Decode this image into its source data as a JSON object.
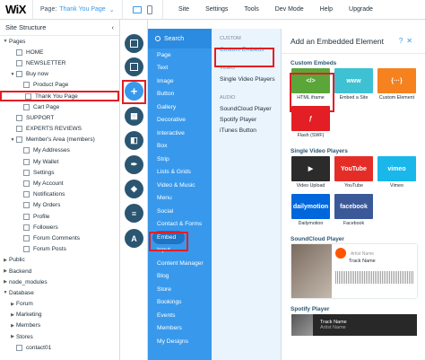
{
  "topbar": {
    "logo": "WiX",
    "page_label": "Page:",
    "page_name": "Thank You Page",
    "menu": [
      "Site",
      "Settings",
      "Tools",
      "Dev Mode",
      "Help",
      "Upgrade"
    ]
  },
  "structure": {
    "title": "Site Structure",
    "rows": [
      {
        "label": "Pages",
        "indent": 0,
        "caret": "▼",
        "icon": false
      },
      {
        "label": "HOME",
        "indent": 1,
        "caret": "",
        "icon": true
      },
      {
        "label": "NEWSLETTER",
        "indent": 1,
        "caret": "",
        "icon": true
      },
      {
        "label": "Buy now",
        "indent": 1,
        "caret": "▼",
        "icon": true
      },
      {
        "label": "Product Page",
        "indent": 2,
        "caret": "",
        "icon": true
      },
      {
        "label": "Thank You Page",
        "indent": 2,
        "caret": "",
        "icon": true,
        "selected": true
      },
      {
        "label": "Cart Page",
        "indent": 2,
        "caret": "",
        "icon": true
      },
      {
        "label": "SUPPORT",
        "indent": 1,
        "caret": "",
        "icon": true
      },
      {
        "label": "EXPERTS REVIEWS",
        "indent": 1,
        "caret": "",
        "icon": true
      },
      {
        "label": "Member's Area (members)",
        "indent": 1,
        "caret": "▼",
        "icon": true
      },
      {
        "label": "My Addresses",
        "indent": 2,
        "caret": "",
        "icon": true
      },
      {
        "label": "My Wallet",
        "indent": 2,
        "caret": "",
        "icon": true
      },
      {
        "label": "Settings",
        "indent": 2,
        "caret": "",
        "icon": true
      },
      {
        "label": "My Account",
        "indent": 2,
        "caret": "",
        "icon": true
      },
      {
        "label": "Notifications",
        "indent": 2,
        "caret": "",
        "icon": true
      },
      {
        "label": "My Orders",
        "indent": 2,
        "caret": "",
        "icon": true
      },
      {
        "label": "Profile",
        "indent": 2,
        "caret": "",
        "icon": true
      },
      {
        "label": "Followers",
        "indent": 2,
        "caret": "",
        "icon": true
      },
      {
        "label": "Forum Comments",
        "indent": 2,
        "caret": "",
        "icon": true
      },
      {
        "label": "Forum Posts",
        "indent": 2,
        "caret": "",
        "icon": true
      },
      {
        "label": "Public",
        "indent": 0,
        "caret": "▶",
        "icon": false
      },
      {
        "label": "Backend",
        "indent": 0,
        "caret": "▶",
        "icon": false
      },
      {
        "label": "node_modules",
        "indent": 0,
        "caret": "▶",
        "icon": false
      },
      {
        "label": "Database",
        "indent": 0,
        "caret": "▼",
        "icon": false
      },
      {
        "label": "Forum",
        "indent": 1,
        "caret": "▶",
        "icon": false
      },
      {
        "label": "Marketing",
        "indent": 1,
        "caret": "▶",
        "icon": false
      },
      {
        "label": "Members",
        "indent": 1,
        "caret": "▶",
        "icon": false
      },
      {
        "label": "Stores",
        "indent": 1,
        "caret": "▶",
        "icon": false
      },
      {
        "label": "contact01",
        "indent": 1,
        "caret": "",
        "icon": true
      }
    ]
  },
  "add_panel": {
    "search_label": "Search",
    "categories": [
      "Page",
      "Text",
      "Image",
      "Button",
      "Gallery",
      "Decorative",
      "Interactive",
      "Box",
      "Strip",
      "Lists & Grids",
      "Video & Music",
      "Menu",
      "Social",
      "Contact & Forms",
      "Embed",
      "Input",
      "Content Manager",
      "Blog",
      "Store",
      "Bookings",
      "Events",
      "Members",
      "My Designs"
    ],
    "active_category": "Embed",
    "sub_sections": [
      {
        "head": "CUSTOM",
        "items": [
          "Custom Embeds"
        ]
      },
      {
        "head": "VIDEO",
        "items": [
          "Single Video Players"
        ]
      },
      {
        "head": "AUDIO",
        "items": [
          "SoundCloud Player",
          "Spotify Player",
          "iTunes Button"
        ]
      }
    ],
    "active_sub": "Custom Embeds"
  },
  "elements": {
    "title": "Add an Embedded Element",
    "custom_heading": "Custom Embeds",
    "custom_tiles": [
      {
        "label": "HTML iframe",
        "glyph": "</>",
        "color": "#5ba639"
      },
      {
        "label": "Embed a Site",
        "glyph": "www",
        "color": "#3ec1d3"
      },
      {
        "label": "Custom Element",
        "glyph": "{···}",
        "color": "#f5821f"
      },
      {
        "label": "Flash (SWF)",
        "glyph": "ƒ",
        "color": "#e31e24"
      }
    ],
    "video_heading": "Single Video Players",
    "video_tiles": [
      {
        "label": "Video Upload",
        "glyph": "▶",
        "color": "#2b2b2b"
      },
      {
        "label": "YouTube",
        "glyph": "YouTube",
        "color": "#e52d27"
      },
      {
        "label": "Vimeo",
        "glyph": "vimeo",
        "color": "#1ab7ea"
      },
      {
        "label": "Dailymotion",
        "glyph": "dailymotion",
        "color": "#0066dc"
      },
      {
        "label": "Facebook",
        "glyph": "facebook",
        "color": "#3b5998"
      }
    ],
    "soundcloud_heading": "SoundCloud Player",
    "soundcloud": {
      "artist": "Artist Name",
      "track": "Track Name"
    },
    "spotify_heading": "Spotify Player",
    "spotify": {
      "track": "Track Name",
      "artist": "Artist Name"
    }
  },
  "colors": {
    "accent": "#3899ec",
    "highlight": "#e31e24",
    "iconbg": "#2b5672"
  }
}
